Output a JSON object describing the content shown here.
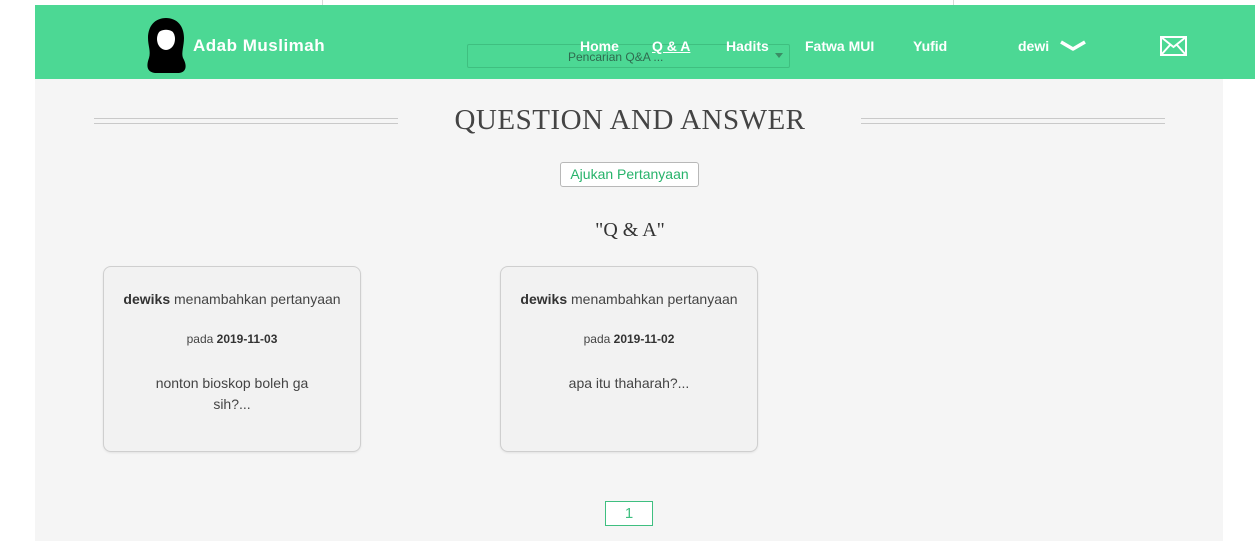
{
  "brand": {
    "name": "Adab Muslimah"
  },
  "search": {
    "placeholder": "Pencarian Q&A ..."
  },
  "nav": {
    "home": "Home",
    "qa": "Q & A",
    "hadits": "Hadits",
    "fatwa": "Fatwa MUI",
    "yufid": "Yufid",
    "user": "dewi"
  },
  "page": {
    "title": "QUESTION AND ANSWER",
    "ask_button": "Ajukan Pertanyaan",
    "section_title": "\"Q & A\""
  },
  "questions": [
    {
      "author": "dewiks",
      "action": "menambahkan pertanyaan",
      "date_prefix": "pada",
      "date": "2019-11-03",
      "text": "nonton bioskop boleh ga sih?..."
    },
    {
      "author": "dewiks",
      "action": "menambahkan pertanyaan",
      "date_prefix": "pada",
      "date": "2019-11-02",
      "text": "apa itu thaharah?..."
    }
  ],
  "pagination": {
    "current": "1"
  },
  "colors": {
    "navbar": "#4cd894",
    "accent": "#27b36b",
    "content_bg": "#f5f5f5"
  },
  "icons": {
    "logo": "hijab-woman-icon",
    "user_menu": "chevron-down-icon",
    "messages": "envelope-icon"
  }
}
